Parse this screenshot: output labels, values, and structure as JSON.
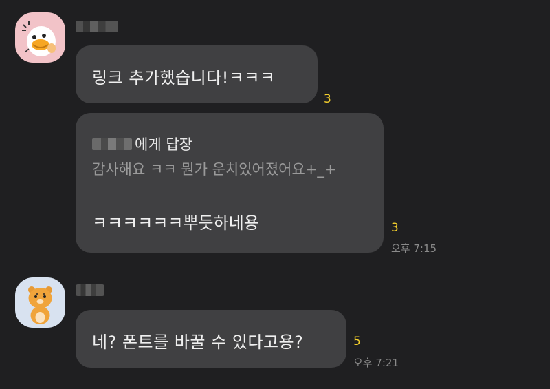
{
  "messages": [
    {
      "text": "링크 추가했습니다!ㅋㅋㅋ",
      "unread": "3"
    },
    {
      "reply_suffix": "에게 답장",
      "quoted_text": "감사해요 ㅋㅋ 뭔가 운치있어졌어요+_+",
      "text": "ㅋㅋㅋㅋㅋㅋ뿌듯하네용",
      "unread": "3",
      "time": "오후 7:15"
    },
    {
      "text": "네? 폰트를 바꿀 수 있다고용?",
      "unread": "5",
      "time": "오후 7:21"
    }
  ],
  "colors": {
    "background": "#1f1f21",
    "bubble": "#404042",
    "unread": "#f5d02c",
    "time": "#8a8a8a",
    "avatar_1_bg": "#f2c3c8",
    "avatar_2_bg": "#d8e2f0"
  },
  "icons": {
    "avatar_1": "duck-character-avatar",
    "avatar_2": "lion-character-avatar"
  }
}
